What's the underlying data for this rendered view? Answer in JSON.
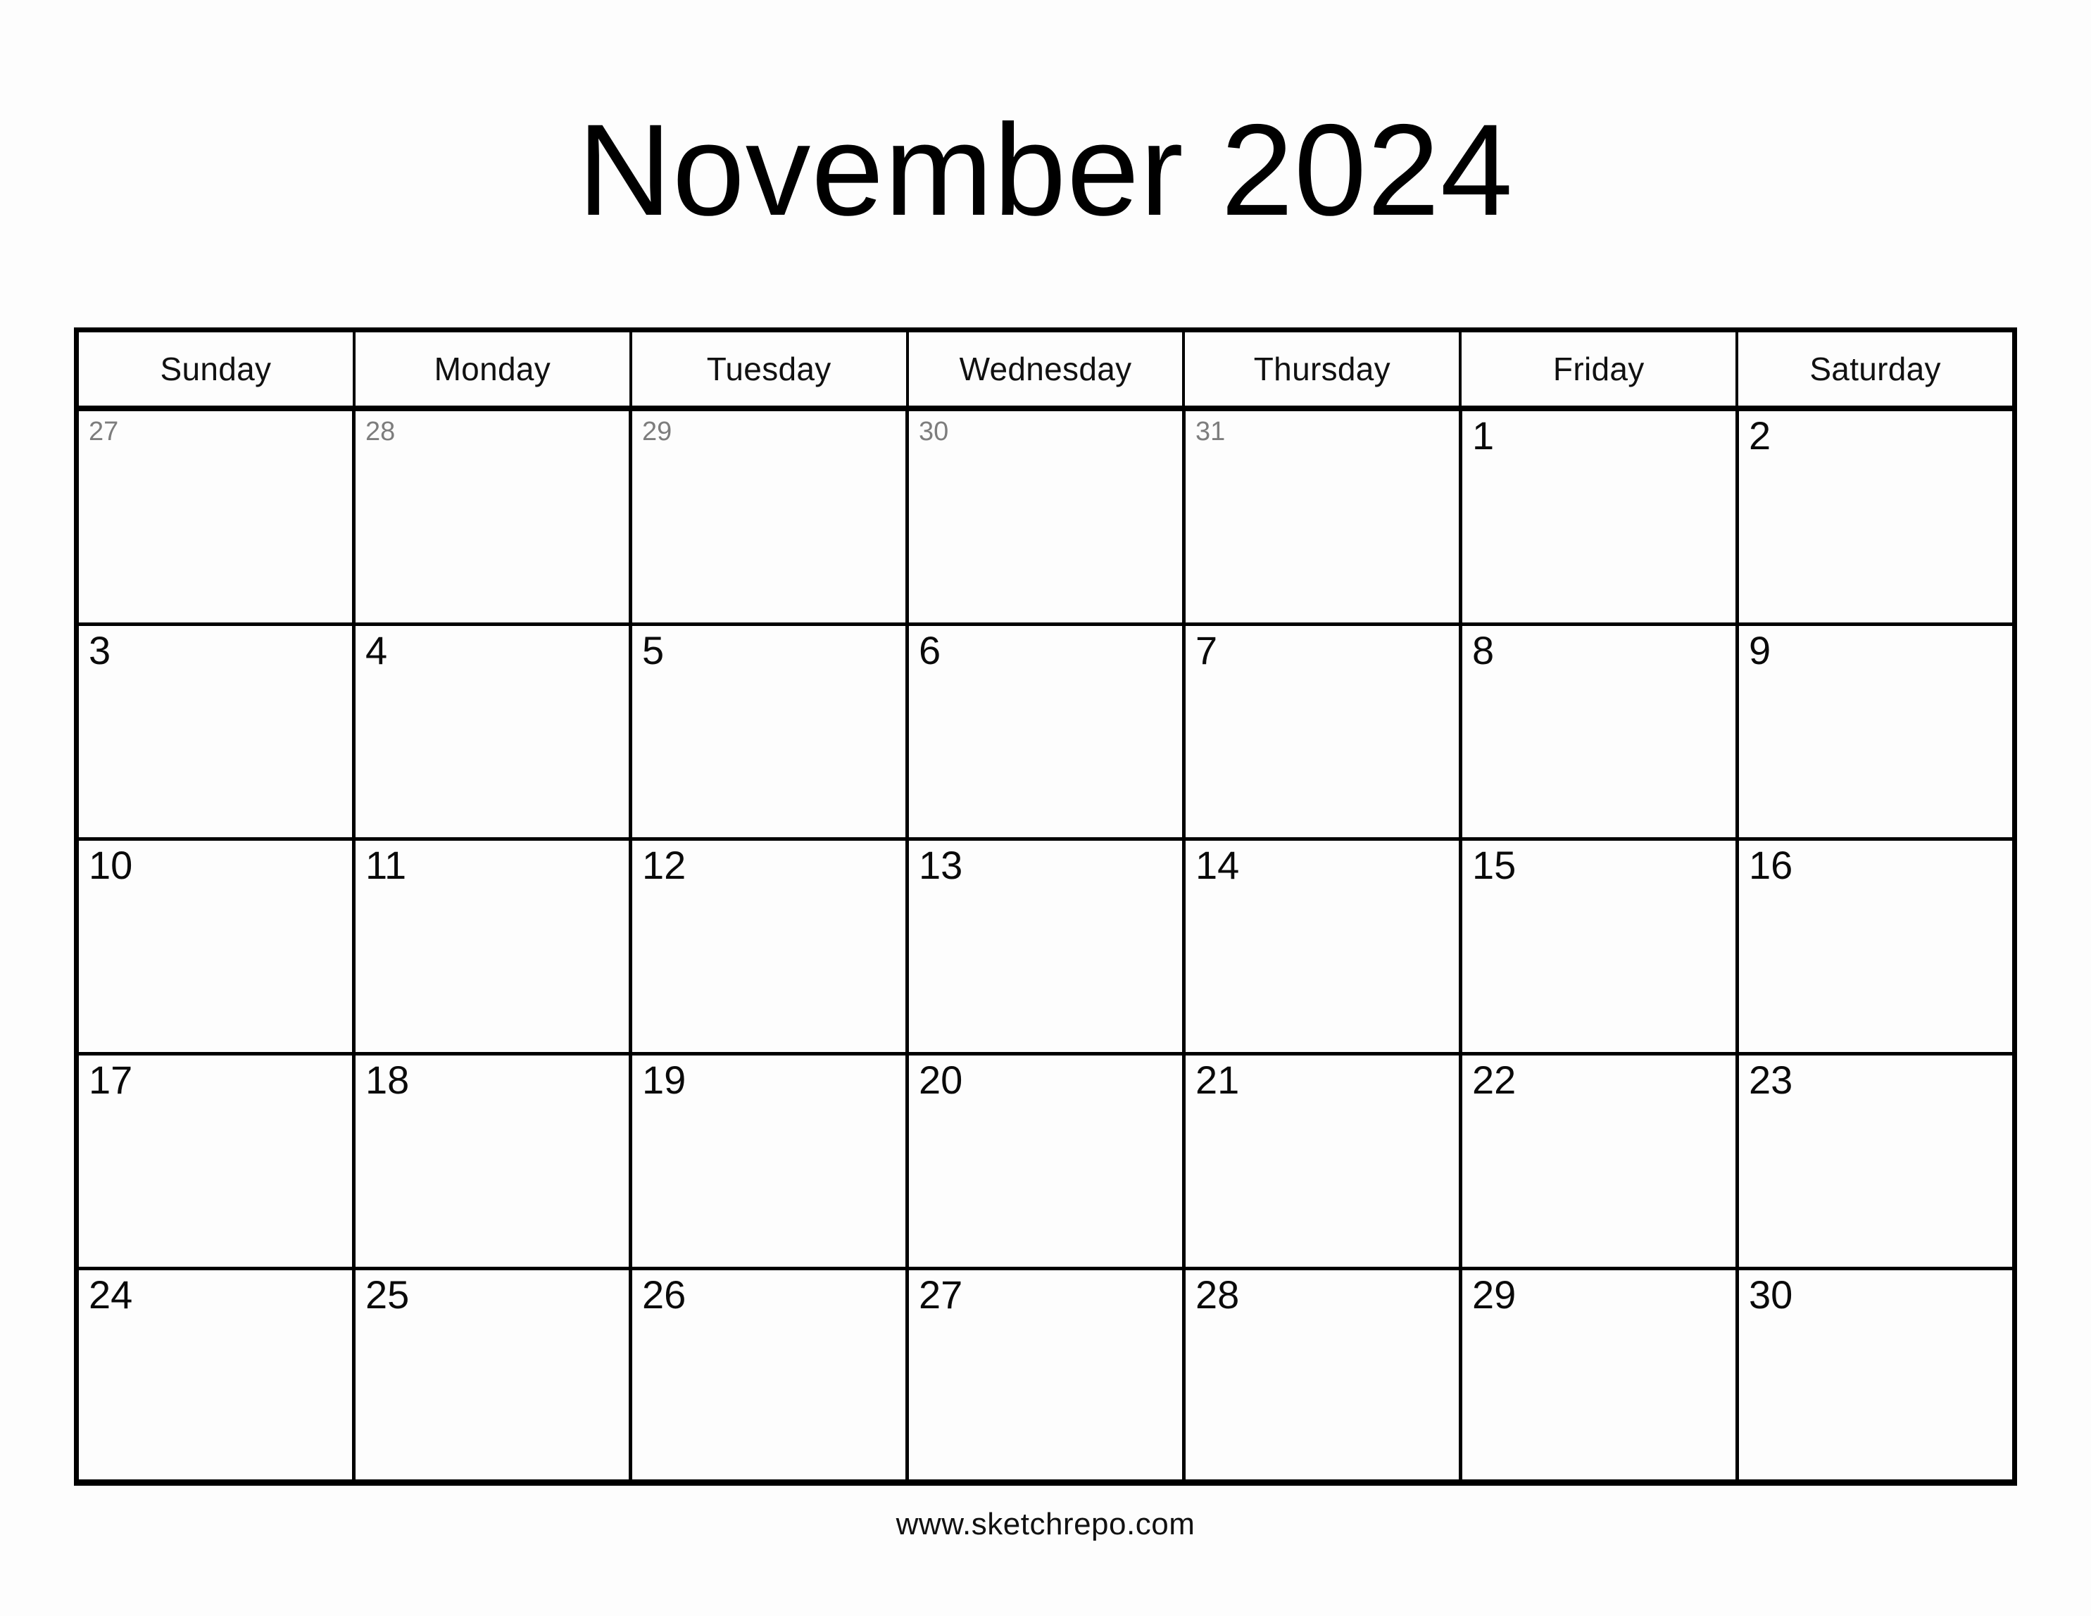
{
  "header": {
    "title": "November 2024",
    "month": "November",
    "year": "2024"
  },
  "calendar": {
    "weekday_headers": [
      "Sunday",
      "Monday",
      "Tuesday",
      "Wednesday",
      "Thursday",
      "Friday",
      "Saturday"
    ],
    "weeks": [
      [
        {
          "num": "27",
          "in_month": false
        },
        {
          "num": "28",
          "in_month": false
        },
        {
          "num": "29",
          "in_month": false
        },
        {
          "num": "30",
          "in_month": false
        },
        {
          "num": "31",
          "in_month": false
        },
        {
          "num": "1",
          "in_month": true
        },
        {
          "num": "2",
          "in_month": true
        }
      ],
      [
        {
          "num": "3",
          "in_month": true
        },
        {
          "num": "4",
          "in_month": true
        },
        {
          "num": "5",
          "in_month": true
        },
        {
          "num": "6",
          "in_month": true
        },
        {
          "num": "7",
          "in_month": true
        },
        {
          "num": "8",
          "in_month": true
        },
        {
          "num": "9",
          "in_month": true
        }
      ],
      [
        {
          "num": "10",
          "in_month": true
        },
        {
          "num": "11",
          "in_month": true
        },
        {
          "num": "12",
          "in_month": true
        },
        {
          "num": "13",
          "in_month": true
        },
        {
          "num": "14",
          "in_month": true
        },
        {
          "num": "15",
          "in_month": true
        },
        {
          "num": "16",
          "in_month": true
        }
      ],
      [
        {
          "num": "17",
          "in_month": true
        },
        {
          "num": "18",
          "in_month": true
        },
        {
          "num": "19",
          "in_month": true
        },
        {
          "num": "20",
          "in_month": true
        },
        {
          "num": "21",
          "in_month": true
        },
        {
          "num": "22",
          "in_month": true
        },
        {
          "num": "23",
          "in_month": true
        }
      ],
      [
        {
          "num": "24",
          "in_month": true
        },
        {
          "num": "25",
          "in_month": true
        },
        {
          "num": "26",
          "in_month": true
        },
        {
          "num": "27",
          "in_month": true
        },
        {
          "num": "28",
          "in_month": true
        },
        {
          "num": "29",
          "in_month": true
        },
        {
          "num": "30",
          "in_month": true
        }
      ]
    ]
  },
  "footer": {
    "url": "www.sketchrepo.com"
  },
  "colors": {
    "page_background": "#fdfdfd",
    "grid_line": "#000000",
    "in_month_text": "#0a0a0a",
    "out_of_month_text": "#7d7d7d",
    "title_text": "#000000"
  }
}
